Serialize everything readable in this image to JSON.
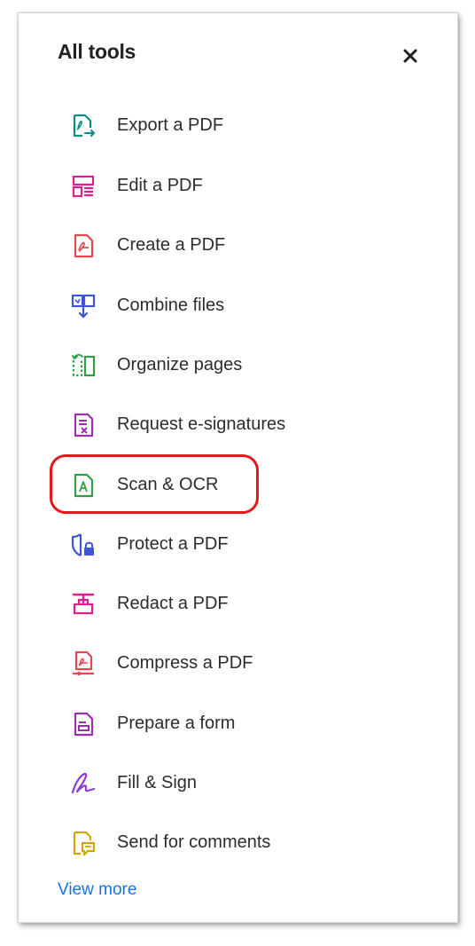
{
  "panel": {
    "title": "All tools",
    "close_icon": "close-icon",
    "view_more": "View more"
  },
  "tools": [
    {
      "label": "Export a PDF",
      "icon": "export-pdf-icon",
      "color": "#0f8c84"
    },
    {
      "label": "Edit a PDF",
      "icon": "edit-pdf-icon",
      "color": "#dd1e8e"
    },
    {
      "label": "Create a PDF",
      "icon": "create-pdf-icon",
      "color": "#e34850"
    },
    {
      "label": "Combine files",
      "icon": "combine-files-icon",
      "color": "#3f55d9"
    },
    {
      "label": "Organize pages",
      "icon": "organize-pages-icon",
      "color": "#2ea043"
    },
    {
      "label": "Request e-signatures",
      "icon": "request-esignatures-icon",
      "color": "#9b2fb0"
    },
    {
      "label": "Scan & OCR",
      "icon": "scan-ocr-icon",
      "color": "#2ea043",
      "highlighted": true
    },
    {
      "label": "Protect a PDF",
      "icon": "protect-pdf-icon",
      "color": "#3f55d9"
    },
    {
      "label": "Redact a PDF",
      "icon": "redact-pdf-icon",
      "color": "#dd1e8e"
    },
    {
      "label": "Compress a PDF",
      "icon": "compress-pdf-icon",
      "color": "#e34850"
    },
    {
      "label": "Prepare a form",
      "icon": "prepare-form-icon",
      "color": "#9b2fb0"
    },
    {
      "label": "Fill & Sign",
      "icon": "fill-sign-icon",
      "color": "#8c3fd1"
    },
    {
      "label": "Send for comments",
      "icon": "send-comments-icon",
      "color": "#d6a400"
    }
  ],
  "highlight_color": "#e21a1a",
  "link_color": "#1473e6"
}
